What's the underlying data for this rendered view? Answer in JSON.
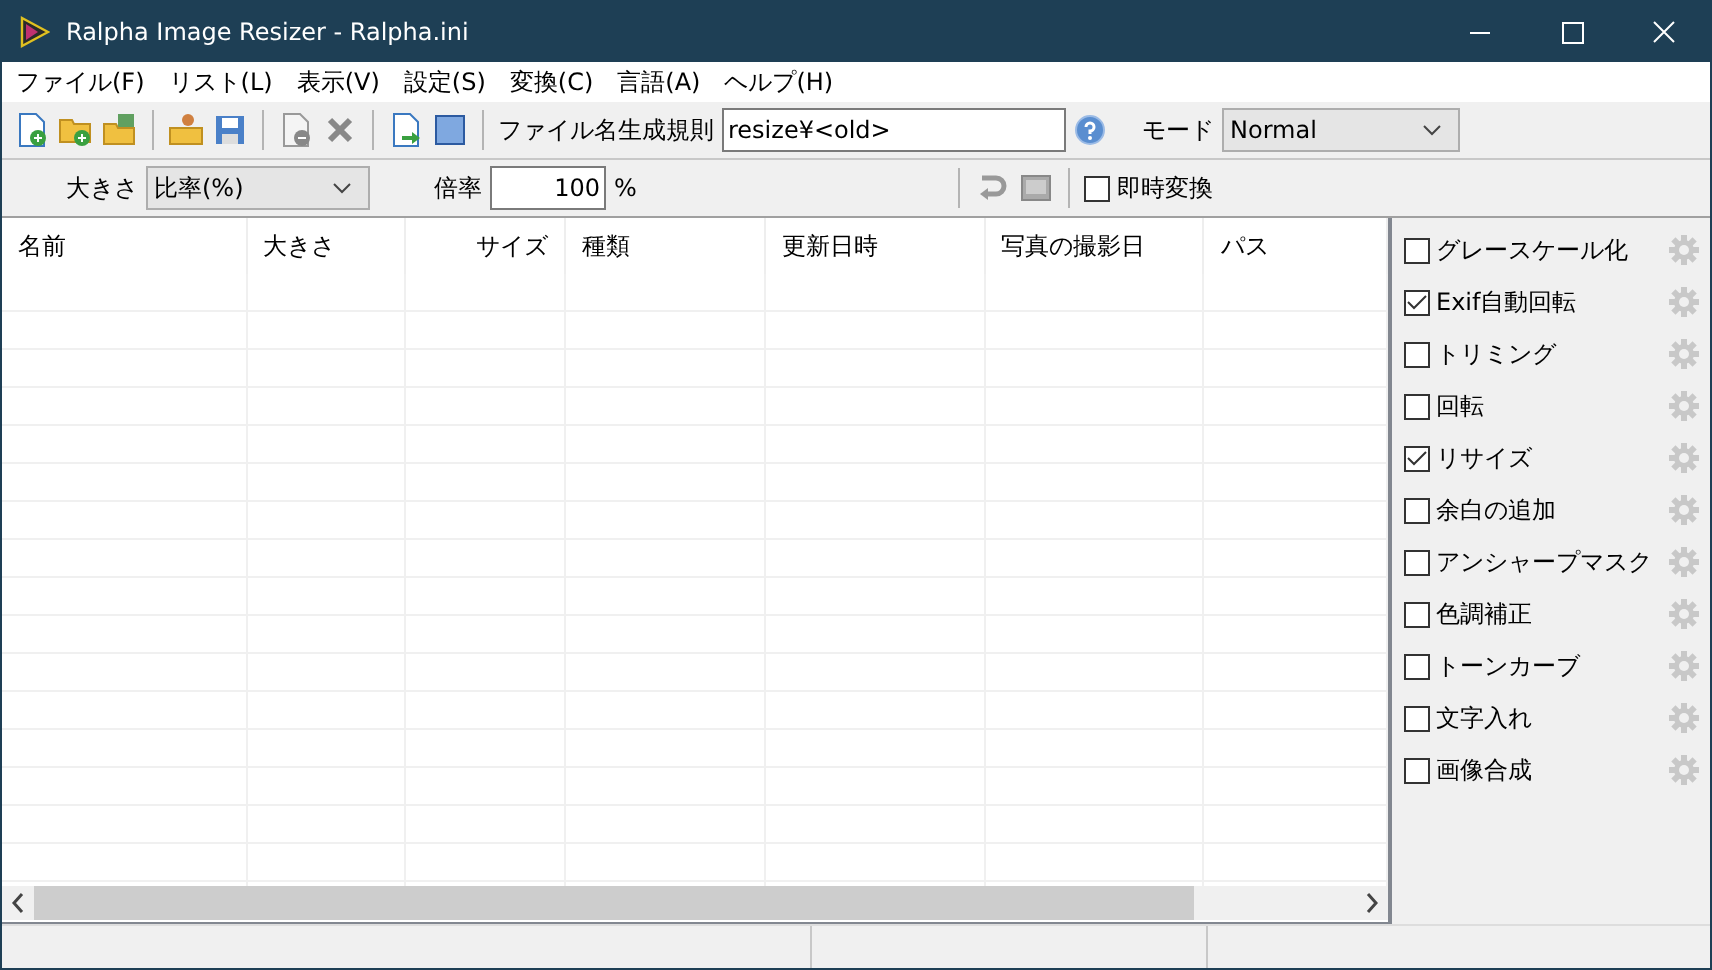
{
  "window": {
    "title": "Ralpha Image Resizer - Ralpha.ini"
  },
  "menu": [
    "ファイル(F)",
    "リスト(L)",
    "表示(V)",
    "設定(S)",
    "変換(C)",
    "言語(A)",
    "ヘルプ(H)"
  ],
  "toolbar": {
    "filename_rule_label": "ファイル名生成規則",
    "filename_rule": "resize¥<old>",
    "mode_label": "モード",
    "mode": "Normal"
  },
  "size_bar": {
    "size_label": "大きさ",
    "size_mode": "比率(%)",
    "scale_label": "倍率",
    "scale": "100",
    "scale_unit": "%",
    "instant_label": "即時変換",
    "instant_checked": false
  },
  "table": {
    "columns": [
      {
        "label": "名前"
      },
      {
        "label": "大きさ"
      },
      {
        "label": "サイズ"
      },
      {
        "label": "種類"
      },
      {
        "label": "更新日時"
      },
      {
        "label": "写真の撮影日"
      },
      {
        "label": "パス"
      }
    ]
  },
  "filters": [
    {
      "label": "グレースケール化",
      "checked": false
    },
    {
      "label": "Exif自動回転",
      "checked": true
    },
    {
      "label": "トリミング",
      "checked": false
    },
    {
      "label": "回転",
      "checked": false
    },
    {
      "label": "リサイズ",
      "checked": true
    },
    {
      "label": "余白の追加",
      "checked": false
    },
    {
      "label": "アンシャープマスク",
      "checked": false
    },
    {
      "label": "色調補正",
      "checked": false
    },
    {
      "label": "トーンカーブ",
      "checked": false
    },
    {
      "label": "文字入れ",
      "checked": false
    },
    {
      "label": "画像合成",
      "checked": false
    }
  ]
}
